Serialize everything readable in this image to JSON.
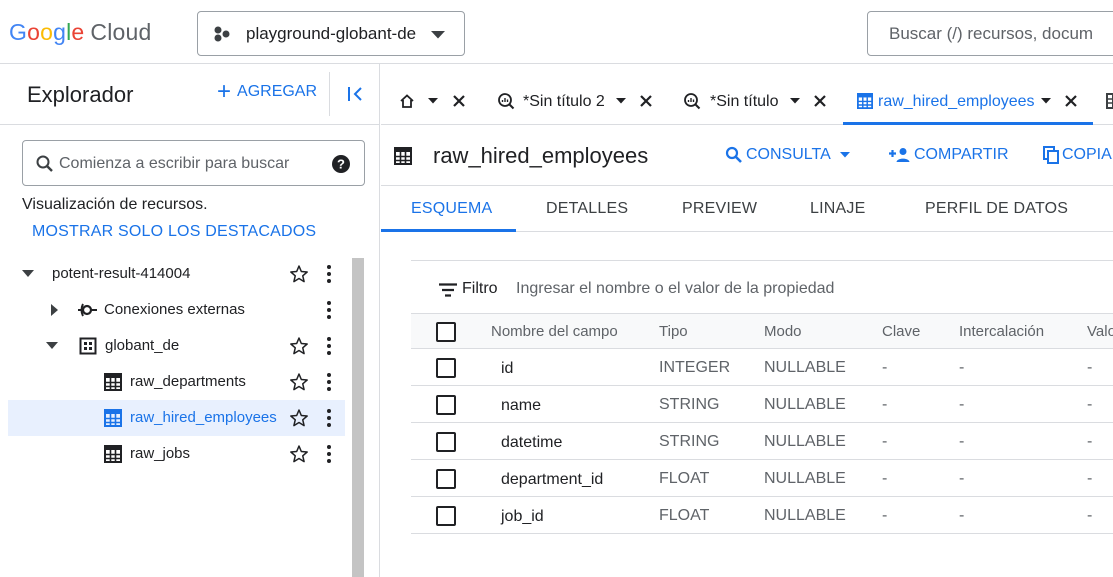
{
  "header": {
    "logo_google": [
      "G",
      "o",
      "o",
      "g",
      "l",
      "e"
    ],
    "logo_cloud": "Cloud",
    "project_name": "playground-globant-de",
    "search_placeholder": "Buscar (/) recursos, docum"
  },
  "explorer": {
    "title": "Explorador",
    "add_label": "AGREGAR",
    "search_placeholder": "Comienza a escribir para buscar",
    "resources_text": "Visualización de recursos.",
    "starred_link": "MOSTRAR SOLO LOS DESTACADOS",
    "tree": {
      "project": "potent-result-414004",
      "external": "Conexiones externas",
      "dataset": "globant_de",
      "tables": [
        "raw_departments",
        "raw_hired_employees",
        "raw_jobs"
      ]
    }
  },
  "tabs": [
    {
      "label": ""
    },
    {
      "label": "*Sin título 2"
    },
    {
      "label": "*Sin título"
    },
    {
      "label": "raw_hired_employees"
    }
  ],
  "resource": {
    "title": "raw_hired_employees",
    "actions": {
      "query": "CONSULTA",
      "share": "COMPARTIR",
      "copy": "COPIA"
    }
  },
  "subtabs": [
    "ESQUEMA",
    "DETALLES",
    "PREVIEW",
    "LINAJE",
    "PERFIL DE DATOS"
  ],
  "schema": {
    "filter_label": "Filtro",
    "filter_placeholder": "Ingresar el nombre o el valor de la propiedad",
    "columns": [
      "Nombre del campo",
      "Tipo",
      "Modo",
      "Clave",
      "Intercalación",
      "Valo"
    ],
    "rows": [
      {
        "name": "id",
        "type": "INTEGER",
        "mode": "NULLABLE",
        "key": "-",
        "collation": "-",
        "default": "-"
      },
      {
        "name": "name",
        "type": "STRING",
        "mode": "NULLABLE",
        "key": "-",
        "collation": "-",
        "default": "-"
      },
      {
        "name": "datetime",
        "type": "STRING",
        "mode": "NULLABLE",
        "key": "-",
        "collation": "-",
        "default": "-"
      },
      {
        "name": "department_id",
        "type": "FLOAT",
        "mode": "NULLABLE",
        "key": "-",
        "collation": "-",
        "default": "-"
      },
      {
        "name": "job_id",
        "type": "FLOAT",
        "mode": "NULLABLE",
        "key": "-",
        "collation": "-",
        "default": "-"
      }
    ]
  },
  "colors": {
    "accent": "#1a73e8",
    "text": "#202124",
    "muted": "#5f6368",
    "border": "#dadce0",
    "selected_bg": "#e8f0fe"
  }
}
